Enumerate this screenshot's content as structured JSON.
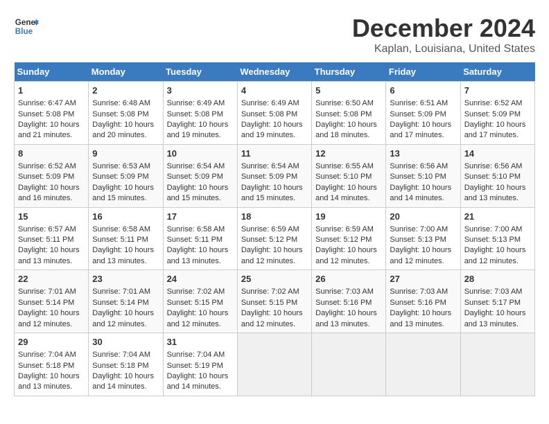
{
  "header": {
    "logo_line1": "General",
    "logo_line2": "Blue",
    "month": "December 2024",
    "location": "Kaplan, Louisiana, United States"
  },
  "days_of_week": [
    "Sunday",
    "Monday",
    "Tuesday",
    "Wednesday",
    "Thursday",
    "Friday",
    "Saturday"
  ],
  "weeks": [
    [
      {
        "day": "1",
        "lines": [
          "Sunrise: 6:47 AM",
          "Sunset: 5:08 PM",
          "Daylight: 10 hours",
          "and 21 minutes."
        ]
      },
      {
        "day": "2",
        "lines": [
          "Sunrise: 6:48 AM",
          "Sunset: 5:08 PM",
          "Daylight: 10 hours",
          "and 20 minutes."
        ]
      },
      {
        "day": "3",
        "lines": [
          "Sunrise: 6:49 AM",
          "Sunset: 5:08 PM",
          "Daylight: 10 hours",
          "and 19 minutes."
        ]
      },
      {
        "day": "4",
        "lines": [
          "Sunrise: 6:49 AM",
          "Sunset: 5:08 PM",
          "Daylight: 10 hours",
          "and 19 minutes."
        ]
      },
      {
        "day": "5",
        "lines": [
          "Sunrise: 6:50 AM",
          "Sunset: 5:08 PM",
          "Daylight: 10 hours",
          "and 18 minutes."
        ]
      },
      {
        "day": "6",
        "lines": [
          "Sunrise: 6:51 AM",
          "Sunset: 5:09 PM",
          "Daylight: 10 hours",
          "and 17 minutes."
        ]
      },
      {
        "day": "7",
        "lines": [
          "Sunrise: 6:52 AM",
          "Sunset: 5:09 PM",
          "Daylight: 10 hours",
          "and 17 minutes."
        ]
      }
    ],
    [
      {
        "day": "8",
        "lines": [
          "Sunrise: 6:52 AM",
          "Sunset: 5:09 PM",
          "Daylight: 10 hours",
          "and 16 minutes."
        ]
      },
      {
        "day": "9",
        "lines": [
          "Sunrise: 6:53 AM",
          "Sunset: 5:09 PM",
          "Daylight: 10 hours",
          "and 15 minutes."
        ]
      },
      {
        "day": "10",
        "lines": [
          "Sunrise: 6:54 AM",
          "Sunset: 5:09 PM",
          "Daylight: 10 hours",
          "and 15 minutes."
        ]
      },
      {
        "day": "11",
        "lines": [
          "Sunrise: 6:54 AM",
          "Sunset: 5:09 PM",
          "Daylight: 10 hours",
          "and 15 minutes."
        ]
      },
      {
        "day": "12",
        "lines": [
          "Sunrise: 6:55 AM",
          "Sunset: 5:10 PM",
          "Daylight: 10 hours",
          "and 14 minutes."
        ]
      },
      {
        "day": "13",
        "lines": [
          "Sunrise: 6:56 AM",
          "Sunset: 5:10 PM",
          "Daylight: 10 hours",
          "and 14 minutes."
        ]
      },
      {
        "day": "14",
        "lines": [
          "Sunrise: 6:56 AM",
          "Sunset: 5:10 PM",
          "Daylight: 10 hours",
          "and 13 minutes."
        ]
      }
    ],
    [
      {
        "day": "15",
        "lines": [
          "Sunrise: 6:57 AM",
          "Sunset: 5:11 PM",
          "Daylight: 10 hours",
          "and 13 minutes."
        ]
      },
      {
        "day": "16",
        "lines": [
          "Sunrise: 6:58 AM",
          "Sunset: 5:11 PM",
          "Daylight: 10 hours",
          "and 13 minutes."
        ]
      },
      {
        "day": "17",
        "lines": [
          "Sunrise: 6:58 AM",
          "Sunset: 5:11 PM",
          "Daylight: 10 hours",
          "and 13 minutes."
        ]
      },
      {
        "day": "18",
        "lines": [
          "Sunrise: 6:59 AM",
          "Sunset: 5:12 PM",
          "Daylight: 10 hours",
          "and 12 minutes."
        ]
      },
      {
        "day": "19",
        "lines": [
          "Sunrise: 6:59 AM",
          "Sunset: 5:12 PM",
          "Daylight: 10 hours",
          "and 12 minutes."
        ]
      },
      {
        "day": "20",
        "lines": [
          "Sunrise: 7:00 AM",
          "Sunset: 5:13 PM",
          "Daylight: 10 hours",
          "and 12 minutes."
        ]
      },
      {
        "day": "21",
        "lines": [
          "Sunrise: 7:00 AM",
          "Sunset: 5:13 PM",
          "Daylight: 10 hours",
          "and 12 minutes."
        ]
      }
    ],
    [
      {
        "day": "22",
        "lines": [
          "Sunrise: 7:01 AM",
          "Sunset: 5:14 PM",
          "Daylight: 10 hours",
          "and 12 minutes."
        ]
      },
      {
        "day": "23",
        "lines": [
          "Sunrise: 7:01 AM",
          "Sunset: 5:14 PM",
          "Daylight: 10 hours",
          "and 12 minutes."
        ]
      },
      {
        "day": "24",
        "lines": [
          "Sunrise: 7:02 AM",
          "Sunset: 5:15 PM",
          "Daylight: 10 hours",
          "and 12 minutes."
        ]
      },
      {
        "day": "25",
        "lines": [
          "Sunrise: 7:02 AM",
          "Sunset: 5:15 PM",
          "Daylight: 10 hours",
          "and 12 minutes."
        ]
      },
      {
        "day": "26",
        "lines": [
          "Sunrise: 7:03 AM",
          "Sunset: 5:16 PM",
          "Daylight: 10 hours",
          "and 13 minutes."
        ]
      },
      {
        "day": "27",
        "lines": [
          "Sunrise: 7:03 AM",
          "Sunset: 5:16 PM",
          "Daylight: 10 hours",
          "and 13 minutes."
        ]
      },
      {
        "day": "28",
        "lines": [
          "Sunrise: 7:03 AM",
          "Sunset: 5:17 PM",
          "Daylight: 10 hours",
          "and 13 minutes."
        ]
      }
    ],
    [
      {
        "day": "29",
        "lines": [
          "Sunrise: 7:04 AM",
          "Sunset: 5:18 PM",
          "Daylight: 10 hours",
          "and 13 minutes."
        ]
      },
      {
        "day": "30",
        "lines": [
          "Sunrise: 7:04 AM",
          "Sunset: 5:18 PM",
          "Daylight: 10 hours",
          "and 14 minutes."
        ]
      },
      {
        "day": "31",
        "lines": [
          "Sunrise: 7:04 AM",
          "Sunset: 5:19 PM",
          "Daylight: 10 hours",
          "and 14 minutes."
        ]
      },
      {
        "day": "",
        "lines": []
      },
      {
        "day": "",
        "lines": []
      },
      {
        "day": "",
        "lines": []
      },
      {
        "day": "",
        "lines": []
      }
    ]
  ]
}
